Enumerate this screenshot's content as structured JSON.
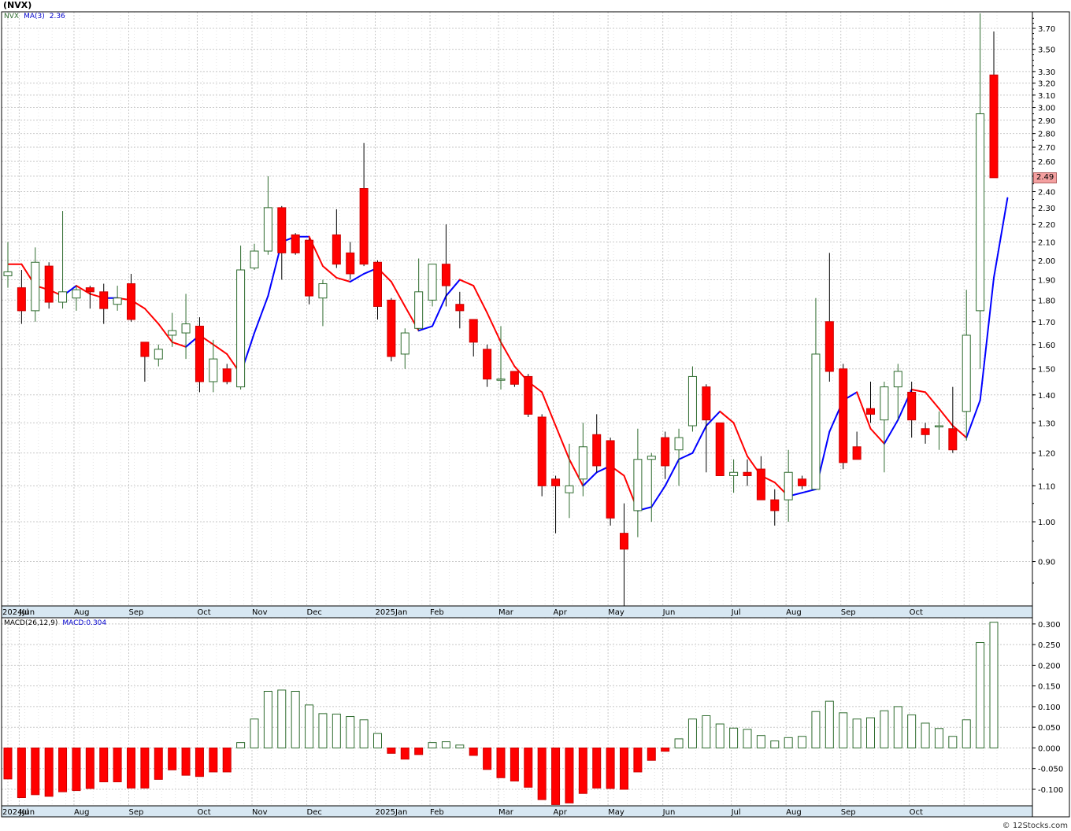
{
  "header": {
    "ticker": "(NVX)"
  },
  "legend_top": {
    "symbol": "NVX",
    "ma_label": "MA(3)",
    "ma_value": "2.36"
  },
  "legend_bottom": {
    "macd_params": "MACD(26,12,9)",
    "macd_value": "MACD:0.304"
  },
  "last_price_tag": "2.49",
  "watermark": "© 12Stocks.com",
  "colors": {
    "up": "#2e6b2e",
    "down": "#ff0000",
    "ma_up": "#0000ff",
    "ma_down": "#ff0000",
    "grid": "#c8c8c8",
    "axis_band": "#d7e7f2"
  },
  "chart_data": [
    {
      "type": "candlestick",
      "title": "",
      "yscale": "log",
      "ylim": [
        0.8,
        3.85
      ],
      "yticks": [
        "0.90",
        "1.00",
        "1.10",
        "1.20",
        "1.30",
        "1.40",
        "1.50",
        "1.60",
        "1.70",
        "1.80",
        "1.90",
        "2.00",
        "2.10",
        "2.20",
        "2.30",
        "2.40",
        "2.50",
        "2.60",
        "2.70",
        "2.80",
        "2.90",
        "3.00",
        "3.10",
        "3.20",
        "3.30",
        "3.50",
        "3.70"
      ],
      "xticks": [
        "2024Jun",
        "Jul",
        "Aug",
        "Sep",
        "Oct",
        "Nov",
        "Dec",
        "2025Jan",
        "Feb",
        "Mar",
        "Apr",
        "May",
        "Jun",
        "Jul",
        "Aug",
        "Sep",
        "Oct"
      ],
      "candles": [
        {
          "date": "2024-05-31",
          "o": 1.92,
          "h": 2.1,
          "l": 1.86,
          "c": 1.94
        },
        {
          "date": "2024-06-07",
          "o": 1.86,
          "h": 1.95,
          "l": 1.69,
          "c": 1.75
        },
        {
          "date": "2024-06-14",
          "o": 1.75,
          "h": 2.07,
          "l": 1.7,
          "c": 1.99
        },
        {
          "date": "2024-06-21",
          "o": 1.97,
          "h": 1.99,
          "l": 1.76,
          "c": 1.79
        },
        {
          "date": "2024-06-28",
          "o": 1.79,
          "h": 2.28,
          "l": 1.76,
          "c": 1.84
        },
        {
          "date": "2024-07-05",
          "o": 1.81,
          "h": 1.87,
          "l": 1.75,
          "c": 1.85
        },
        {
          "date": "2024-07-12",
          "o": 1.86,
          "h": 1.87,
          "l": 1.76,
          "c": 1.84
        },
        {
          "date": "2024-07-19",
          "o": 1.84,
          "h": 1.88,
          "l": 1.69,
          "c": 1.76
        },
        {
          "date": "2024-07-26",
          "o": 1.78,
          "h": 1.87,
          "l": 1.75,
          "c": 1.81
        },
        {
          "date": "2024-08-02",
          "o": 1.88,
          "h": 1.93,
          "l": 1.7,
          "c": 1.71
        },
        {
          "date": "2024-08-09",
          "o": 1.61,
          "h": 1.61,
          "l": 1.45,
          "c": 1.55
        },
        {
          "date": "2024-08-16",
          "o": 1.54,
          "h": 1.6,
          "l": 1.51,
          "c": 1.58
        },
        {
          "date": "2024-08-23",
          "o": 1.64,
          "h": 1.74,
          "l": 1.59,
          "c": 1.66
        },
        {
          "date": "2024-08-30",
          "o": 1.65,
          "h": 1.83,
          "l": 1.54,
          "c": 1.69
        },
        {
          "date": "2024-09-06",
          "o": 1.68,
          "h": 1.72,
          "l": 1.41,
          "c": 1.45
        },
        {
          "date": "2024-09-13",
          "o": 1.45,
          "h": 1.62,
          "l": 1.41,
          "c": 1.54
        },
        {
          "date": "2024-09-20",
          "o": 1.5,
          "h": 1.52,
          "l": 1.44,
          "c": 1.45
        },
        {
          "date": "2024-09-27",
          "o": 1.43,
          "h": 2.08,
          "l": 1.42,
          "c": 1.95
        },
        {
          "date": "2024-10-04",
          "o": 1.96,
          "h": 2.09,
          "l": 1.95,
          "c": 2.05
        },
        {
          "date": "2024-10-11",
          "o": 2.05,
          "h": 2.5,
          "l": 2.03,
          "c": 2.3
        },
        {
          "date": "2024-10-18",
          "o": 2.3,
          "h": 2.31,
          "l": 1.9,
          "c": 2.04
        },
        {
          "date": "2024-10-25",
          "o": 2.14,
          "h": 2.15,
          "l": 2.03,
          "c": 2.04
        },
        {
          "date": "2024-11-01",
          "o": 2.11,
          "h": 2.12,
          "l": 1.78,
          "c": 1.82
        },
        {
          "date": "2024-11-08",
          "o": 1.81,
          "h": 1.9,
          "l": 1.68,
          "c": 1.88
        },
        {
          "date": "2024-11-15",
          "o": 2.14,
          "h": 2.29,
          "l": 1.96,
          "c": 1.98
        },
        {
          "date": "2024-11-22",
          "o": 2.04,
          "h": 2.1,
          "l": 1.9,
          "c": 1.93
        },
        {
          "date": "2024-11-29",
          "o": 2.42,
          "h": 2.73,
          "l": 1.97,
          "c": 1.98
        },
        {
          "date": "2024-12-06",
          "o": 1.99,
          "h": 2.0,
          "l": 1.71,
          "c": 1.77
        },
        {
          "date": "2024-12-13",
          "o": 1.8,
          "h": 1.81,
          "l": 1.53,
          "c": 1.55
        },
        {
          "date": "2024-12-20",
          "o": 1.56,
          "h": 1.67,
          "l": 1.5,
          "c": 1.65
        },
        {
          "date": "2024-12-27",
          "o": 1.67,
          "h": 2.01,
          "l": 1.66,
          "c": 1.84
        },
        {
          "date": "2025-01-03",
          "o": 1.8,
          "h": 1.98,
          "l": 1.77,
          "c": 1.98
        },
        {
          "date": "2025-01-10",
          "o": 1.98,
          "h": 2.2,
          "l": 1.77,
          "c": 1.87
        },
        {
          "date": "2025-01-17",
          "o": 1.78,
          "h": 1.84,
          "l": 1.67,
          "c": 1.75
        },
        {
          "date": "2025-01-24",
          "o": 1.71,
          "h": 1.71,
          "l": 1.55,
          "c": 1.61
        },
        {
          "date": "2025-01-31",
          "o": 1.58,
          "h": 1.6,
          "l": 1.43,
          "c": 1.46
        },
        {
          "date": "2025-02-07",
          "o": 1.46,
          "h": 1.68,
          "l": 1.42,
          "c": 1.46
        },
        {
          "date": "2025-02-14",
          "o": 1.49,
          "h": 1.49,
          "l": 1.43,
          "c": 1.44
        },
        {
          "date": "2025-02-21",
          "o": 1.47,
          "h": 1.48,
          "l": 1.32,
          "c": 1.33
        },
        {
          "date": "2025-02-28",
          "o": 1.32,
          "h": 1.33,
          "l": 1.07,
          "c": 1.1
        },
        {
          "date": "2025-03-07",
          "o": 1.12,
          "h": 1.13,
          "l": 0.97,
          "c": 1.1
        },
        {
          "date": "2025-03-14",
          "o": 1.08,
          "h": 1.23,
          "l": 1.01,
          "c": 1.1
        },
        {
          "date": "2025-03-21",
          "o": 1.12,
          "h": 1.3,
          "l": 1.07,
          "c": 1.22
        },
        {
          "date": "2025-03-28",
          "o": 1.26,
          "h": 1.33,
          "l": 1.14,
          "c": 1.16
        },
        {
          "date": "2025-04-04",
          "o": 1.24,
          "h": 1.25,
          "l": 0.99,
          "c": 1.01
        },
        {
          "date": "2025-04-11",
          "o": 0.97,
          "h": 1.05,
          "l": 0.79,
          "c": 0.93
        },
        {
          "date": "2025-04-18",
          "o": 1.03,
          "h": 1.28,
          "l": 0.96,
          "c": 1.18
        },
        {
          "date": "2025-04-25",
          "o": 1.18,
          "h": 1.2,
          "l": 1.0,
          "c": 1.19
        },
        {
          "date": "2025-05-02",
          "o": 1.25,
          "h": 1.27,
          "l": 1.12,
          "c": 1.16
        },
        {
          "date": "2025-05-09",
          "o": 1.21,
          "h": 1.28,
          "l": 1.1,
          "c": 1.25
        },
        {
          "date": "2025-05-16",
          "o": 1.29,
          "h": 1.51,
          "l": 1.27,
          "c": 1.47
        },
        {
          "date": "2025-05-23",
          "o": 1.43,
          "h": 1.44,
          "l": 1.14,
          "c": 1.31
        },
        {
          "date": "2025-05-30",
          "o": 1.3,
          "h": 1.3,
          "l": 1.13,
          "c": 1.13
        },
        {
          "date": "2025-06-06",
          "o": 1.13,
          "h": 1.18,
          "l": 1.08,
          "c": 1.14
        },
        {
          "date": "2025-06-13",
          "o": 1.14,
          "h": 1.18,
          "l": 1.1,
          "c": 1.13
        },
        {
          "date": "2025-06-20",
          "o": 1.15,
          "h": 1.19,
          "l": 1.06,
          "c": 1.06
        },
        {
          "date": "2025-06-27",
          "o": 1.06,
          "h": 1.09,
          "l": 0.99,
          "c": 1.03
        },
        {
          "date": "2025-07-04",
          "o": 1.06,
          "h": 1.21,
          "l": 1.0,
          "c": 1.14
        },
        {
          "date": "2025-07-11",
          "o": 1.12,
          "h": 1.13,
          "l": 1.09,
          "c": 1.1
        },
        {
          "date": "2025-07-18",
          "o": 1.09,
          "h": 1.81,
          "l": 1.09,
          "c": 1.56
        },
        {
          "date": "2025-07-25",
          "o": 1.7,
          "h": 2.04,
          "l": 1.45,
          "c": 1.49
        },
        {
          "date": "2025-08-01",
          "o": 1.5,
          "h": 1.52,
          "l": 1.15,
          "c": 1.17
        },
        {
          "date": "2025-08-08",
          "o": 1.22,
          "h": 1.27,
          "l": 1.18,
          "c": 1.18
        },
        {
          "date": "2025-08-15",
          "o": 1.35,
          "h": 1.45,
          "l": 1.3,
          "c": 1.33
        },
        {
          "date": "2025-08-22",
          "o": 1.31,
          "h": 1.45,
          "l": 1.14,
          "c": 1.43
        },
        {
          "date": "2025-08-29",
          "o": 1.43,
          "h": 1.52,
          "l": 1.31,
          "c": 1.49
        },
        {
          "date": "2025-09-05",
          "o": 1.41,
          "h": 1.45,
          "l": 1.25,
          "c": 1.31
        },
        {
          "date": "2025-09-12",
          "o": 1.28,
          "h": 1.3,
          "l": 1.23,
          "c": 1.26
        },
        {
          "date": "2025-09-19",
          "o": 1.29,
          "h": 1.34,
          "l": 1.21,
          "c": 1.29
        },
        {
          "date": "2025-09-26",
          "o": 1.28,
          "h": 1.43,
          "l": 1.2,
          "c": 1.21
        },
        {
          "date": "2025-10-03",
          "o": 1.34,
          "h": 1.85,
          "l": 1.24,
          "c": 1.64
        },
        {
          "date": "2025-10-10",
          "o": 1.75,
          "h": 3.85,
          "l": 1.5,
          "c": 2.95
        },
        {
          "date": "2025-10-17",
          "o": 3.27,
          "h": 3.67,
          "l": 2.49,
          "c": 2.49
        }
      ],
      "ma3": [
        1.98,
        1.87,
        1.85,
        1.82,
        1.87,
        1.83,
        1.81,
        1.81,
        1.8,
        1.76,
        1.69,
        1.61,
        1.59,
        1.64,
        1.6,
        1.56,
        1.48,
        1.65,
        1.82,
        2.1,
        2.13,
        2.13,
        1.97,
        1.91,
        1.89,
        1.93,
        1.96,
        1.89,
        1.77,
        1.66,
        1.68,
        1.82,
        1.9,
        1.87,
        1.74,
        1.61,
        1.51,
        1.45,
        1.41,
        1.29,
        1.18,
        1.1,
        1.14,
        1.16,
        1.13,
        1.03,
        1.04,
        1.1,
        1.18,
        1.2,
        1.29,
        1.34,
        1.3,
        1.19,
        1.13,
        1.11,
        1.07,
        1.08,
        1.09,
        1.27,
        1.38,
        1.41,
        1.28,
        1.23,
        1.31,
        1.42,
        1.41,
        1.35,
        1.29,
        1.25,
        1.38,
        1.91,
        2.36
      ],
      "last_price": 2.49
    },
    {
      "type": "bar",
      "title": "",
      "ylim": [
        -0.14,
        0.315
      ],
      "yticks": [
        "-0.100",
        "-0.050",
        "0.000",
        "0.050",
        "0.100",
        "0.150",
        "0.200",
        "0.250",
        "0.300"
      ],
      "xticks": [
        "2024Jun",
        "Jul",
        "Aug",
        "Sep",
        "Oct",
        "Nov",
        "Dec",
        "2025Jan",
        "Feb",
        "Mar",
        "Apr",
        "May",
        "Jun",
        "Jul",
        "Aug",
        "Sep",
        "Oct"
      ],
      "series": [
        {
          "values": [
            -0.075,
            -0.12,
            -0.113,
            -0.117,
            -0.106,
            -0.103,
            -0.098,
            -0.082,
            -0.082,
            -0.097,
            -0.097,
            -0.076,
            -0.053,
            -0.066,
            -0.069,
            -0.058,
            -0.058,
            0.013,
            0.07,
            0.137,
            0.14,
            0.137,
            0.104,
            0.083,
            0.082,
            0.076,
            0.068,
            0.035,
            -0.013,
            -0.027,
            -0.016,
            0.013,
            0.015,
            0.007,
            -0.018,
            -0.052,
            -0.072,
            -0.08,
            -0.095,
            -0.125,
            -0.137,
            -0.133,
            -0.11,
            -0.097,
            -0.098,
            -0.1,
            -0.058,
            -0.03,
            -0.008,
            0.022,
            0.07,
            0.078,
            0.058,
            0.048,
            0.045,
            0.03,
            0.017,
            0.025,
            0.028,
            0.088,
            0.113,
            0.085,
            0.07,
            0.073,
            0.09,
            0.1,
            0.08,
            0.06,
            0.047,
            0.028,
            0.068,
            0.255,
            0.304
          ]
        }
      ]
    }
  ]
}
